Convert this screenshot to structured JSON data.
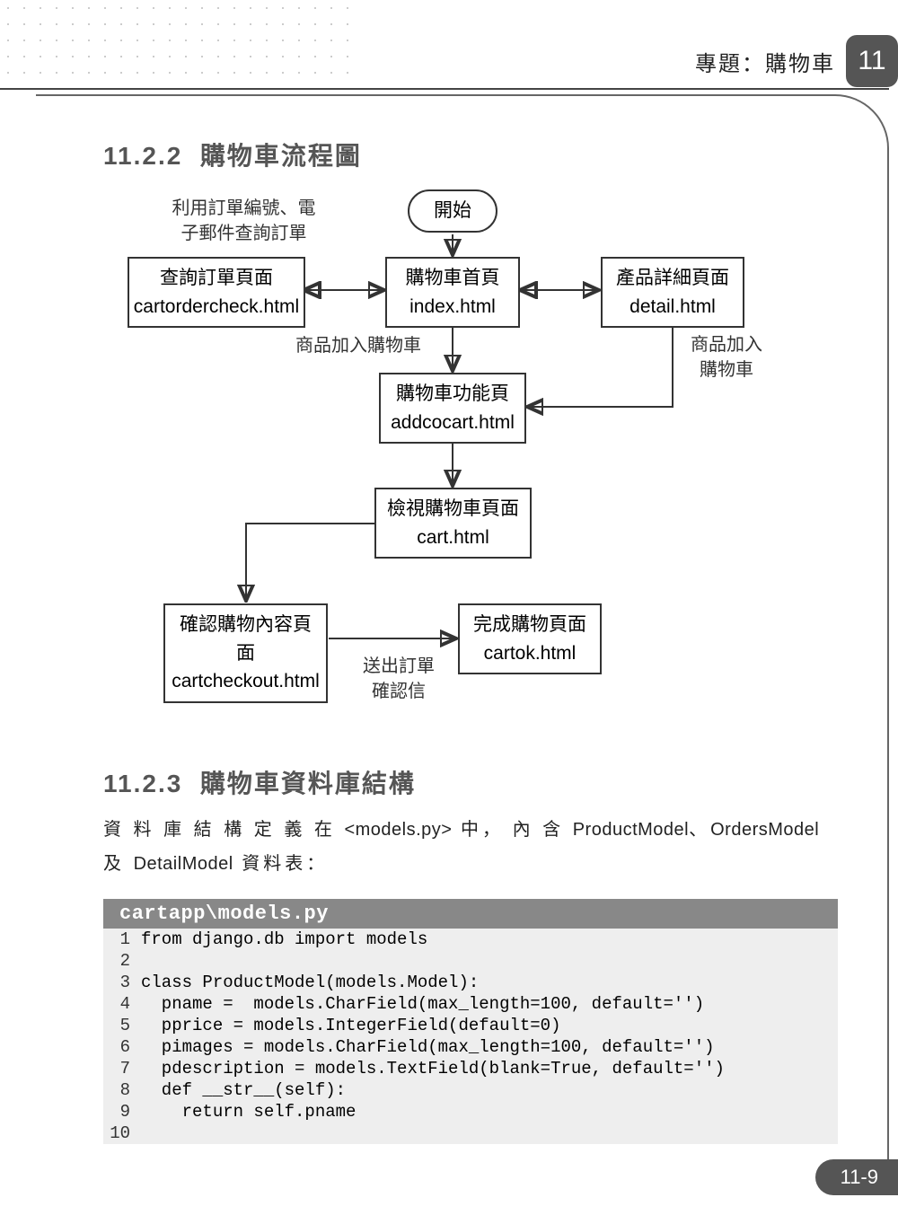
{
  "header": {
    "title": "專題：購物車",
    "chapter": "11"
  },
  "section1": {
    "number": "11.2.2",
    "title": "購物車流程圖"
  },
  "flow": {
    "start": "開始",
    "query_note": "利用訂單編號、電\n子郵件查詢訂單",
    "check": {
      "t": "查詢訂單頁面",
      "f": "cartordercheck.html"
    },
    "index": {
      "t": "購物車首頁",
      "f": "index.html"
    },
    "detail": {
      "t": "產品詳細頁面",
      "f": "detail.html"
    },
    "addcart_note_left": "商品加入購物車",
    "addcart_note_right": "商品加入\n購物車",
    "func": {
      "t": "購物車功能頁",
      "f": "addcocart.html"
    },
    "view": {
      "t": "檢視購物車頁面",
      "f": "cart.html"
    },
    "confirm": {
      "t": "確認購物內容頁面",
      "f": "cartcheckout.html"
    },
    "send_note": "送出訂單\n確認信",
    "ok": {
      "t": "完成購物頁面",
      "f": "cartok.html"
    }
  },
  "section2": {
    "number": "11.2.3",
    "title": "購物車資料庫結構"
  },
  "db_paragraph": {
    "p1": "資 料 庫 結 構 定 義 在 ",
    "file": "<models.py>",
    "p2": " 中， 內 含 ",
    "m1": "ProductModel",
    "sep1": "、",
    "m2": "OrdersModel",
    "p3": " 及 ",
    "m3": "DetailModel",
    "p4": " 資料表："
  },
  "code": {
    "path": "cartapp\\models.py",
    "lines": [
      "from django.db import models",
      "",
      "class ProductModel(models.Model):",
      "  pname =  models.CharField(max_length=100, default='')",
      "  pprice = models.IntegerField(default=0)",
      "  pimages = models.CharField(max_length=100, default='')",
      "  pdescription = models.TextField(blank=True, default='')",
      "  def __str__(self):",
      "    return self.pname",
      ""
    ]
  },
  "footer": "11-9"
}
